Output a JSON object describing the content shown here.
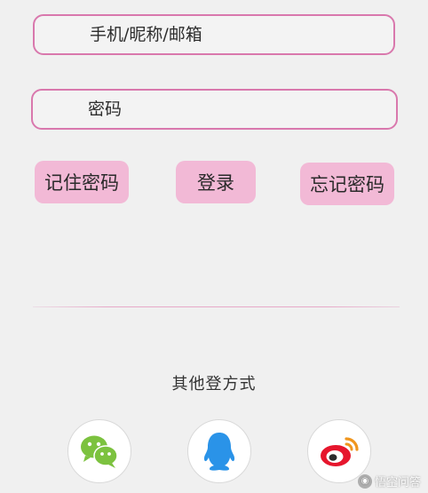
{
  "form": {
    "username_placeholder": "手机/昵称/邮箱",
    "password_placeholder": "密码"
  },
  "buttons": {
    "remember_label": "记住密码",
    "login_label": "登录",
    "forgot_label": "忘记密码"
  },
  "other_login": {
    "label": "其他登方式",
    "providers": [
      {
        "name": "wechat",
        "icon": "wechat-icon"
      },
      {
        "name": "qq",
        "icon": "qq-icon"
      },
      {
        "name": "weibo",
        "icon": "weibo-icon"
      }
    ]
  },
  "watermark": {
    "text": "悟空问答"
  },
  "colors": {
    "field_border": "#d978ad",
    "button_bg": "#f2b9d6",
    "page_bg": "#f0f0f0",
    "wechat_green": "#7cc23f",
    "qq_blue": "#2a93e8",
    "weibo_red": "#e6162d"
  }
}
